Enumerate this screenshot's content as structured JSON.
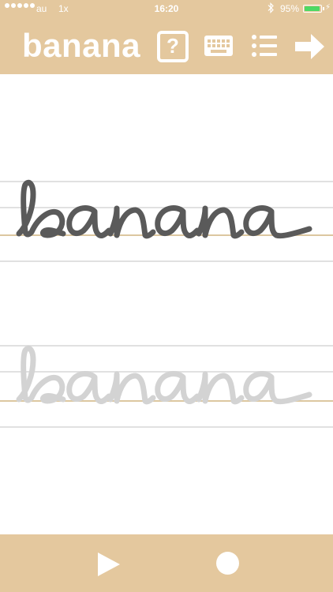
{
  "status_bar": {
    "carrier": "au",
    "zoom": "1x",
    "time": "16:20",
    "battery_percent": "95%",
    "battery_level": 0.95,
    "battery_color": "#4cd964"
  },
  "nav": {
    "title": "banana",
    "help_label": "?",
    "icons": [
      "help-icon",
      "keyboard-icon",
      "list-icon",
      "arrow-right-icon"
    ]
  },
  "worksheet": {
    "word": "banana",
    "trace_color": "#5a5a5a",
    "guide_color": "#d3d3d3"
  },
  "footer": {
    "icons": [
      "play-icon",
      "record-icon"
    ]
  },
  "theme": {
    "bar_color": "#e4c89e",
    "baseline_color": "#dcc7a0",
    "rule_color": "#e1e1e1"
  }
}
